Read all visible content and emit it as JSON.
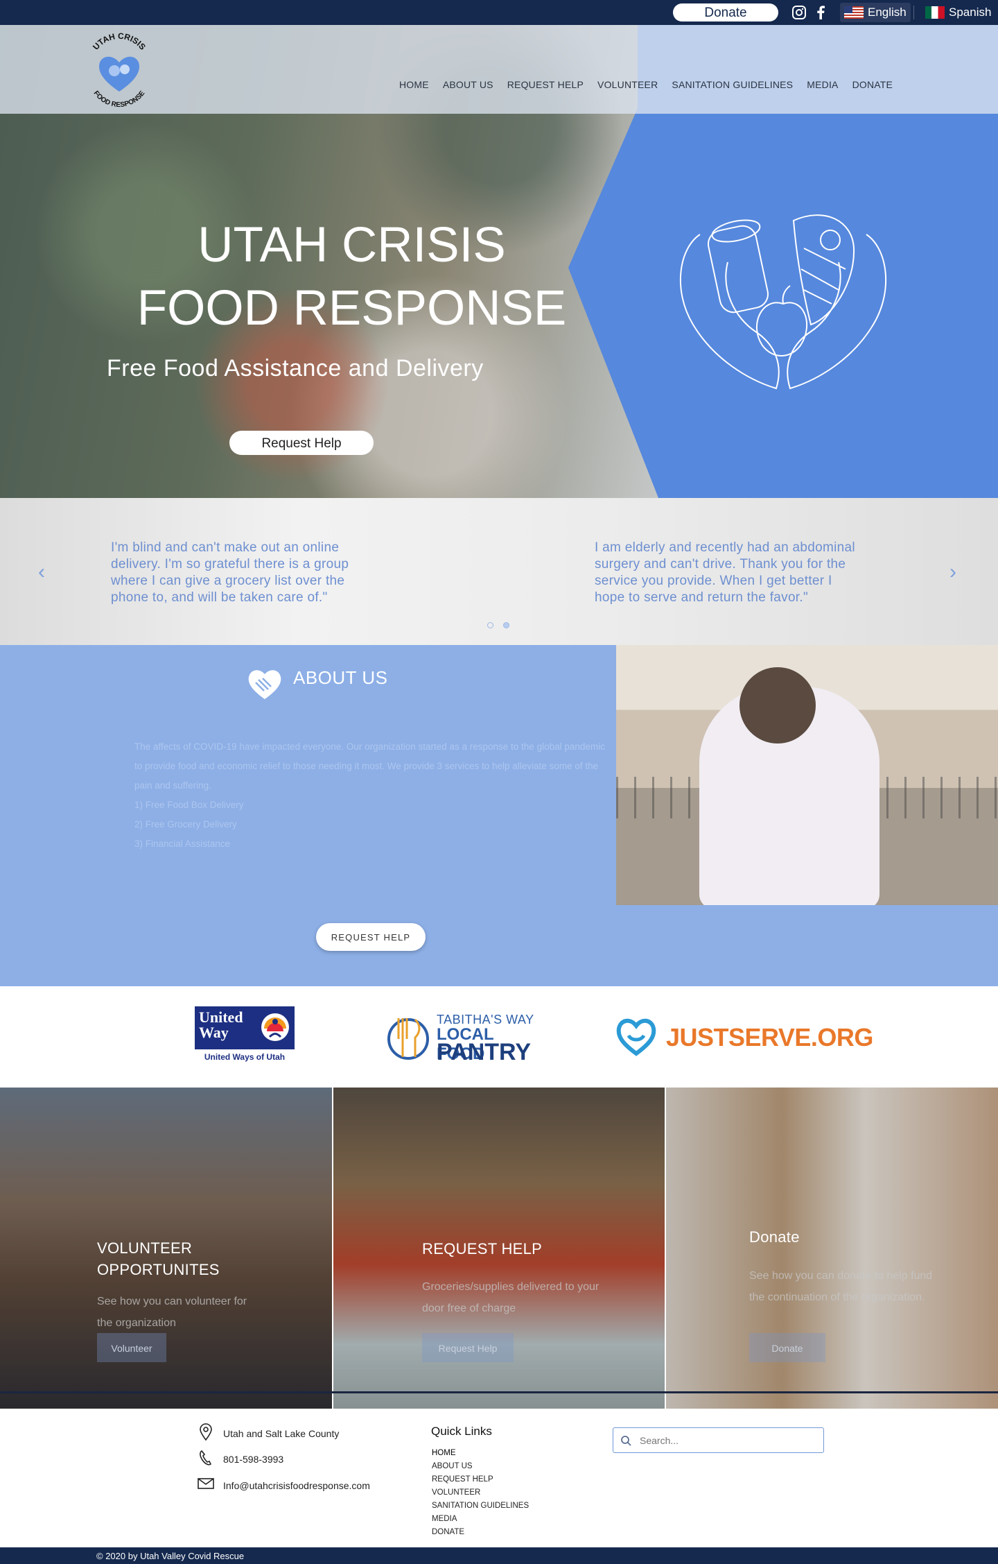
{
  "topbar": {
    "donate_label": "Donate",
    "social": [
      {
        "icon": "instagram-icon",
        "glyph": "◎"
      },
      {
        "icon": "facebook-icon",
        "glyph": "f"
      }
    ],
    "languages": [
      {
        "label": "English",
        "flag": "us-flag-icon",
        "active": true
      },
      {
        "label": "Spanish",
        "flag": "mexico-flag-icon",
        "active": false
      }
    ]
  },
  "header": {
    "logo_top_text": "UTAH CRISIS",
    "logo_bottom_text": "FOOD RESPONSE",
    "nav": [
      "HOME",
      "ABOUT US",
      "REQUEST HELP",
      "VOLUNTEER",
      "SANITATION GUIDELINES",
      "MEDIA",
      "DONATE"
    ]
  },
  "hero": {
    "title_line1": "UTAH CRISIS",
    "title_line2": "FOOD RESPONSE",
    "subtitle": "Free Food Assistance and Delivery",
    "button_label": "Request Help",
    "accent_color": "#5688dd"
  },
  "testimonials": {
    "items": [
      "I'm blind and can't make out an online delivery. I'm so grateful there is a group where I can give a grocery list over the phone to, and will be taken care of.\"",
      "I am elderly and recently had an abdominal surgery and can't drive. Thank you for the service you provide. When I get better I hope to serve and return the favor.\""
    ],
    "prev_icon": "chevron-left-icon",
    "next_icon": "chevron-right-icon",
    "dots": 2
  },
  "about": {
    "title": "ABOUT US",
    "paragraph": "The affects of COVID-19 have impacted everyone. Our organization started as a response to the global pandemic to provide food and economic relief to those needing it most. We provide 3 services to help alleviate some of the pain and suffering.",
    "services": [
      "1) Free Food Box Delivery",
      "2) Free Grocery Delivery",
      "3) Financial Assistance"
    ],
    "button_label": "REQUEST HELP",
    "background_color": "#8dafe6"
  },
  "partners": {
    "united_way": {
      "line1": "United",
      "line2": "Way",
      "caption": "United Ways of Utah"
    },
    "tabithas_way": {
      "line1": "TABITHA'S WAY",
      "line2": "LOCAL FOOD",
      "line3": "PANTRY"
    },
    "justserve": {
      "label": "JUSTSERVE.ORG"
    }
  },
  "cards": [
    {
      "title": "VOLUNTEER OPPORTUNITES",
      "text": "See how you can volunteer for the organization",
      "button": "Volunteer"
    },
    {
      "title": "REQUEST HELP",
      "text": "Groceries/supplies delivered to your door free of charge",
      "button": "Request Help"
    },
    {
      "title": "Donate",
      "text": "See how you can donate to help fund the continuation of the organization.",
      "button": "Donate"
    }
  ],
  "footer": {
    "location": "Utah and Salt Lake County",
    "phone": "801-598-3993",
    "email": "Info@utahcrisisfoodresponse.com",
    "quick_links_title": "Quick Links",
    "quick_links": [
      "HOME",
      "ABOUT US",
      "REQUEST HELP",
      "VOLUNTEER",
      "SANITATION GUIDELINES",
      "MEDIA",
      "DONATE"
    ],
    "search_placeholder": "Search...",
    "copyright": "© 2020 by Utah Valley Covid Rescue"
  }
}
